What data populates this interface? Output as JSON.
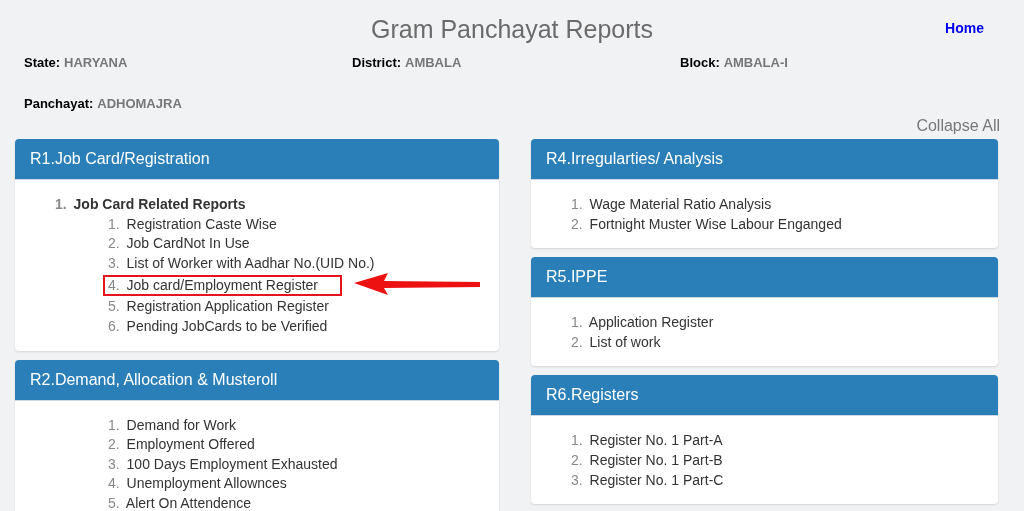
{
  "header": {
    "title": "Gram Panchayat Reports",
    "home_link": "Home"
  },
  "info": [
    {
      "label": "State:",
      "value": "HARYANA"
    },
    {
      "label": "District:",
      "value": "AMBALA"
    },
    {
      "label": "Block:",
      "value": "AMBALA-I"
    },
    {
      "label": "Panchayat:",
      "value": "ADHOMAJRA"
    }
  ],
  "collapse_link": "Collapse All",
  "columns": [
    [
      {
        "title": "R1.Job Card/Registration",
        "kind": "outline",
        "items": [
          {
            "number": "1.",
            "label": "Job Card Related Reports",
            "children": [
              {
                "number": "1.",
                "label": "Registration Caste Wise",
                "highlighted": false
              },
              {
                "number": "2.",
                "label": "Job CardNot In Use",
                "highlighted": false
              },
              {
                "number": "3.",
                "label": "List of Worker with Aadhar No.(UID No.)",
                "highlighted": false
              },
              {
                "number": "4.",
                "label": "Job card/Employment Register",
                "highlighted": true
              },
              {
                "number": "5.",
                "label": "Registration Application Register",
                "highlighted": false
              },
              {
                "number": "6.",
                "label": "Pending JobCards to be Verified",
                "highlighted": false
              }
            ]
          }
        ]
      },
      {
        "title": "R2.Demand, Allocation & Musteroll",
        "kind": "sub",
        "items": [
          {
            "number": "1.",
            "label": "Demand for Work"
          },
          {
            "number": "2.",
            "label": "Employment Offered"
          },
          {
            "number": "3.",
            "label": "100 Days Employment Exhausted"
          },
          {
            "number": "4.",
            "label": "Unemployment Allownces"
          },
          {
            "number": "5.",
            "label": "Alert On Attendence"
          }
        ]
      }
    ],
    [
      {
        "title": "R4.Irregularties/ Analysis",
        "kind": "flat",
        "items": [
          {
            "number": "1.",
            "label": "Wage Material Ratio Analysis"
          },
          {
            "number": "2.",
            "label": "Fortnight Muster Wise Labour Enganged"
          }
        ]
      },
      {
        "title": "R5.IPPE",
        "kind": "flat",
        "items": [
          {
            "number": "1.",
            "label": "Application Register"
          },
          {
            "number": "2.",
            "label": "List of work"
          }
        ]
      },
      {
        "title": "R6.Registers",
        "kind": "flat",
        "items": [
          {
            "number": "1.",
            "label": "Register No. 1 Part-A"
          },
          {
            "number": "2.",
            "label": "Register No. 1 Part-B"
          },
          {
            "number": "3.",
            "label": "Register No. 1 Part-C"
          }
        ]
      }
    ]
  ]
}
